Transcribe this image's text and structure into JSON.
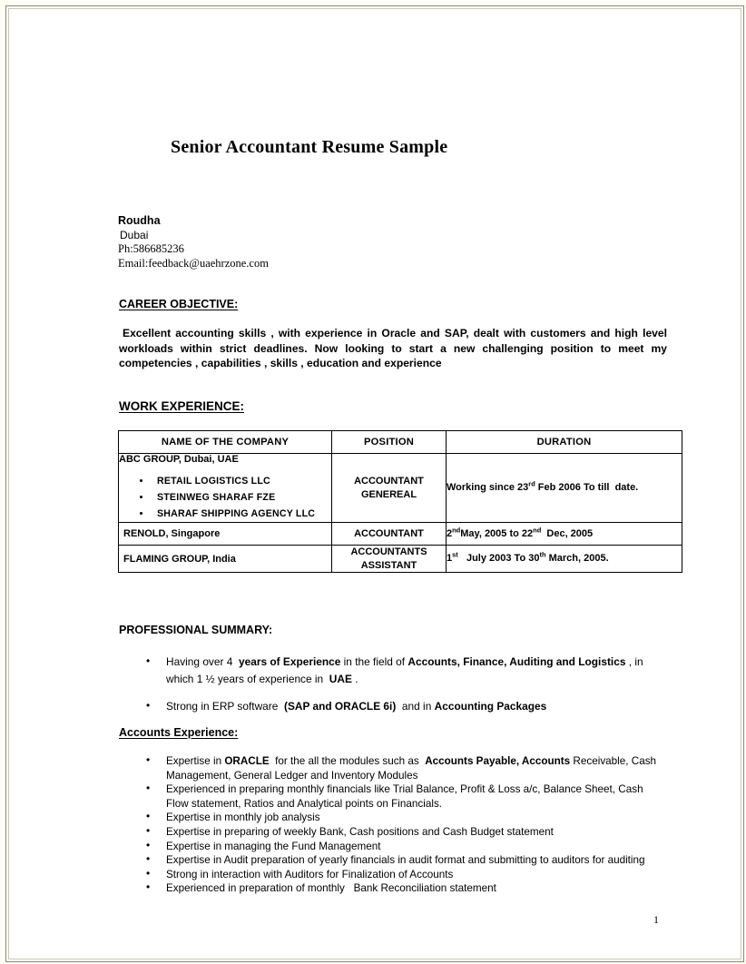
{
  "document": {
    "title": "Senior Accountant Resume Sample",
    "page_number": "1"
  },
  "contact": {
    "name": "Roudha",
    "city": "Dubai",
    "phone": "Ph:586685236",
    "email": "Email:feedback@uaehrzone.com"
  },
  "career_objective": {
    "heading": "CAREER OBJECTIVE:",
    "body": "Excellent  accounting skills , with experience  in Oracle  and SAP,  dealt with  customers  and high level workloads  within strict deadlines. Now  looking to start a new challenging position to meet my competencies , capabilities , skills , education and experience"
  },
  "work_experience": {
    "heading": "WORK EXPERIENCE:",
    "columns": [
      "NAME OF THE COMPANY",
      "POSITION",
      "DURATION"
    ],
    "rows": [
      {
        "company": "ABC GROUP, Dubai, UAE",
        "subsidiaries": [
          "RETAIL LOGISTICS LLC",
          "STEINWEG SHARAF FZE",
          "SHARAF SHIPPING AGENCY LLC"
        ],
        "position_line1": "ACCOUNTANT",
        "position_line2": "GENEREAL",
        "duration_html": "Working since 23<sup>rd</sup> Feb 2006 To till&nbsp;&nbsp;date."
      },
      {
        "company": "RENOLD, Singapore",
        "subsidiaries": [],
        "position_line1": "ACCOUNTANT",
        "position_line2": "",
        "duration_html": "2<sup>nd</sup>May, 2005 to 22<sup>nd</sup>&nbsp; Dec, 2005"
      },
      {
        "company": "FLAMING GROUP, India",
        "subsidiaries": [],
        "position_line1": "ACCOUNTANTS",
        "position_line2": "ASSISTANT",
        "duration_html": "1<sup>st</sup>&nbsp;&nbsp; July 2003 To 30<sup>th</sup> March, 2005."
      }
    ]
  },
  "professional_summary": {
    "heading": "PROFESSIONAL SUMMARY:",
    "bullets_html": [
      "Having over 4 &nbsp;<b>years of Experience</b> in the field of <b>Accounts, Finance, Auditing and Logistics</b> , in which 1 &frac12; years of experience in &nbsp;<b>UAE</b> .",
      "Strong in ERP software &nbsp;<b>(SAP and ORACLE 6i)</b> &nbsp;and in <b>Accounting Packages</b>"
    ]
  },
  "accounts_experience": {
    "heading": "Accounts Experience:",
    "bullets_html": [
      "Expertise in <b>ORACLE</b> &nbsp;for the all the modules such as &nbsp;<b>Accounts Payable, Accounts</b> Receivable, Cash Management, General Ledger and Inventory Modules",
      "Experienced in preparing monthly financials like Trial Balance, Profit &amp; Loss a/c, Balance Sheet, Cash Flow statement, Ratios and Analytical points on Financials.",
      "Expertise in monthly job analysis",
      "Expertise in preparing of weekly Bank, Cash positions and Cash Budget statement",
      "Expertise in managing the Fund Management",
      "Expertise in Audit preparation of yearly financials in audit format and submitting to auditors for auditing",
      "Strong in interaction with Auditors for Finalization of Accounts",
      "Experienced in preparation of monthly &nbsp; Bank Reconciliation statement"
    ]
  }
}
